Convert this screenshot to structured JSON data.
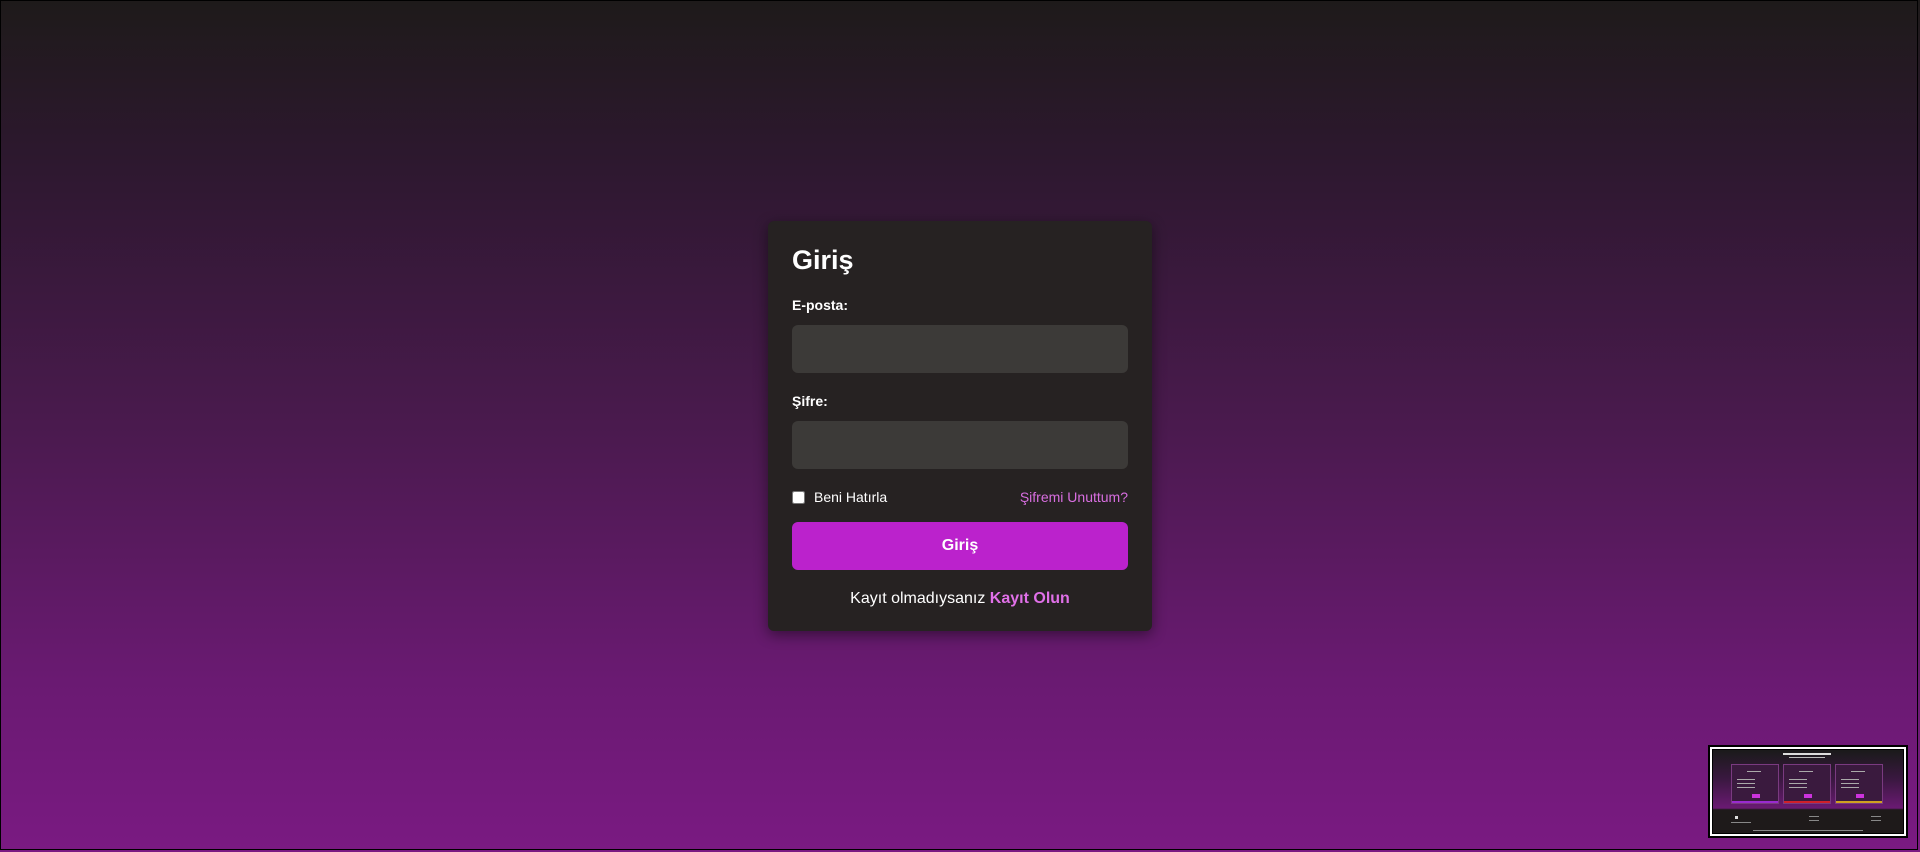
{
  "login": {
    "title": "Giriş",
    "email_label": "E-posta:",
    "email_value": "",
    "password_label": "Şifre:",
    "password_value": "",
    "remember_label": "Beni Hatırla",
    "remember_checked": false,
    "forgot_link": "Şifremi Unuttum?",
    "submit_label": "Giriş",
    "register_prompt": "Kayıt olmadıysanız ",
    "register_link": "Kayıt Olun"
  },
  "colors": {
    "accent": "#bb22cc",
    "link": "#d86ee0",
    "card_bg": "#262222",
    "input_bg": "#3c3a38"
  },
  "thumbnail": {
    "icon": "page-preview-thumbnail"
  }
}
